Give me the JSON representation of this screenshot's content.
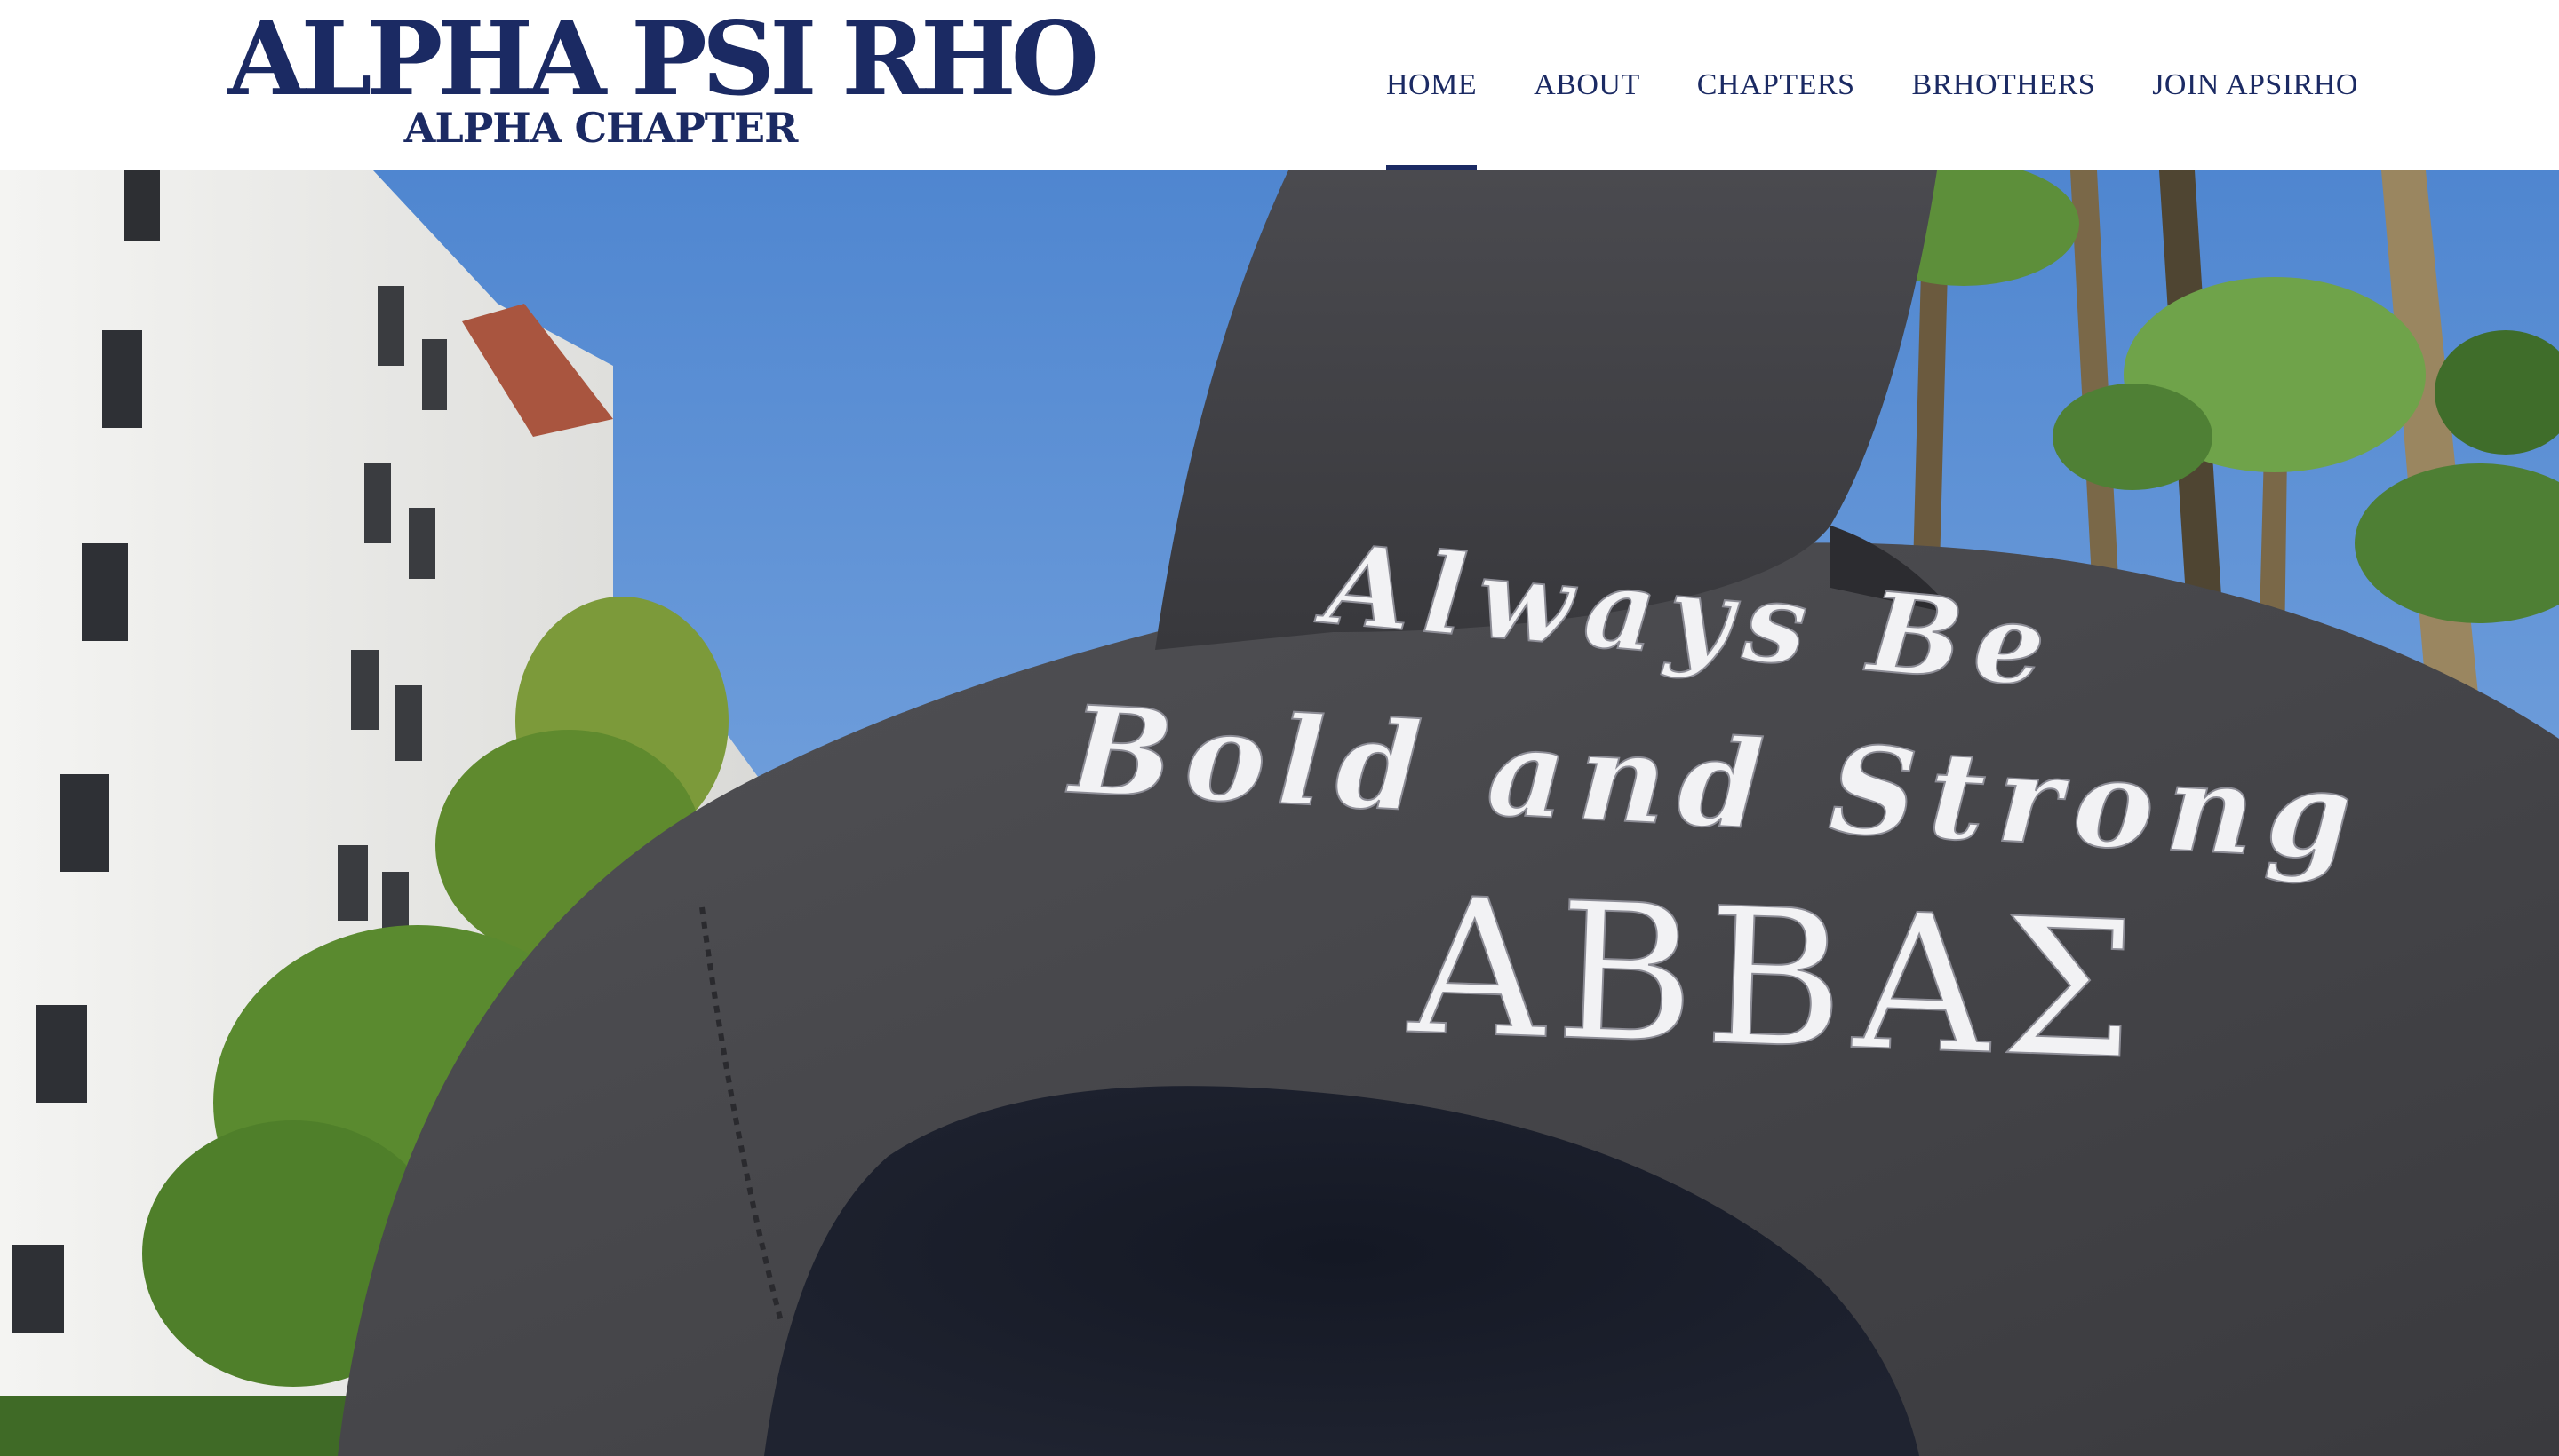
{
  "brand": {
    "name": "ALPHA PSI RHO",
    "chapter": "ALPHA CHAPTER"
  },
  "nav": {
    "items": [
      {
        "label": "HOME",
        "active": true
      },
      {
        "label": "ABOUT",
        "active": false
      },
      {
        "label": "CHAPTERS",
        "active": false
      },
      {
        "label": "BRHOTHERS",
        "active": false
      },
      {
        "label": "JOIN APSIRHO",
        "active": false
      }
    ]
  },
  "hero": {
    "line1": "Always Be",
    "line2": "Bold and Strong",
    "line3": "ΑΒΒΑΣ"
  },
  "colors": {
    "brand": "#1b2a63",
    "sky": "#6f9fd8",
    "hoodie": "#3f3f43",
    "embroidery": "#f2f2f4"
  }
}
